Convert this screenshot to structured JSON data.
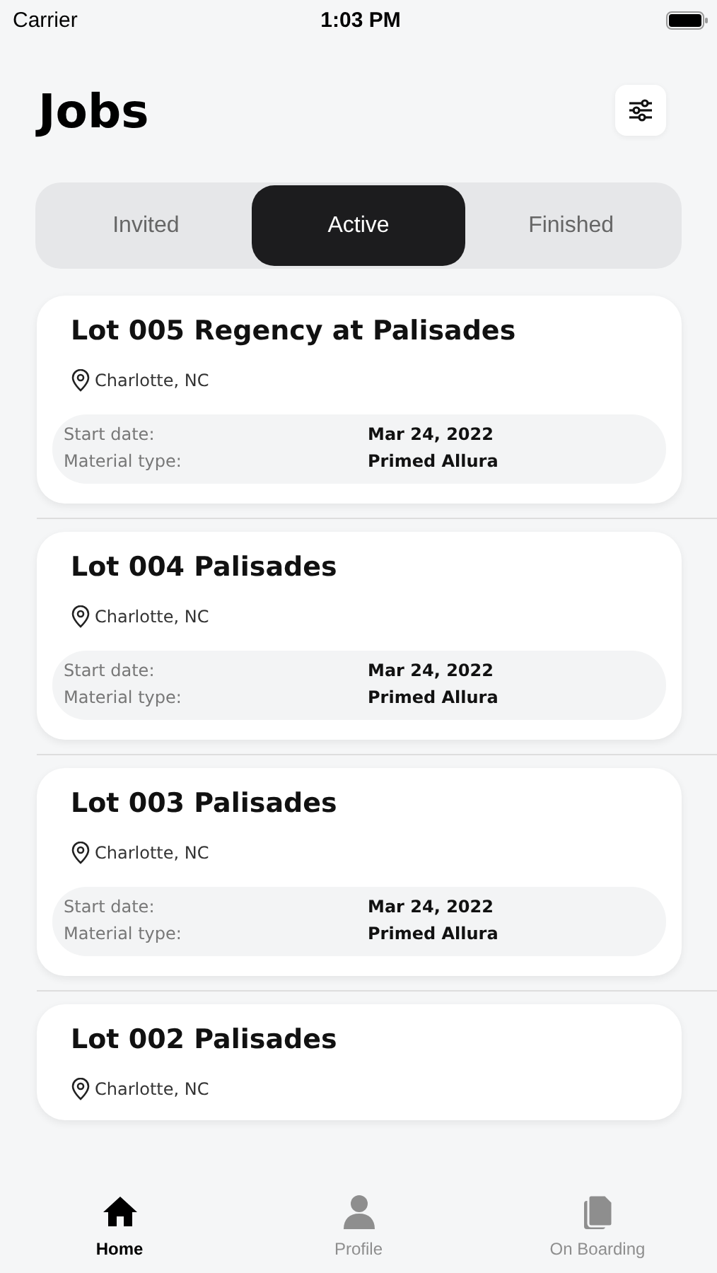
{
  "status_bar": {
    "carrier": "Carrier",
    "time": "1:03 PM"
  },
  "header": {
    "title": "Jobs"
  },
  "tabs": [
    {
      "label": "Invited",
      "selected": false
    },
    {
      "label": "Active",
      "selected": true
    },
    {
      "label": "Finished",
      "selected": false
    }
  ],
  "jobs": [
    {
      "title": "Lot 005 Regency at Palisades",
      "location": "Charlotte, NC",
      "details": [
        {
          "label": "Start date:",
          "value": "Mar 24, 2022"
        },
        {
          "label": "Material type:",
          "value": "Primed Allura"
        }
      ]
    },
    {
      "title": "Lot 004 Palisades",
      "location": "Charlotte, NC",
      "details": [
        {
          "label": "Start date:",
          "value": "Mar 24, 2022"
        },
        {
          "label": "Material type:",
          "value": "Primed Allura"
        }
      ]
    },
    {
      "title": "Lot 003 Palisades",
      "location": "Charlotte, NC",
      "details": [
        {
          "label": "Start date:",
          "value": "Mar 24, 2022"
        },
        {
          "label": "Material type:",
          "value": "Primed Allura"
        }
      ]
    },
    {
      "title": "Lot 002 Palisades",
      "location": "Charlotte, NC"
    }
  ],
  "tab_bar": [
    {
      "kind": "home",
      "label": "Home",
      "selected": true
    },
    {
      "kind": "profile",
      "label": "Profile",
      "selected": false
    },
    {
      "kind": "documents",
      "label": "On Boarding",
      "selected": false
    }
  ]
}
